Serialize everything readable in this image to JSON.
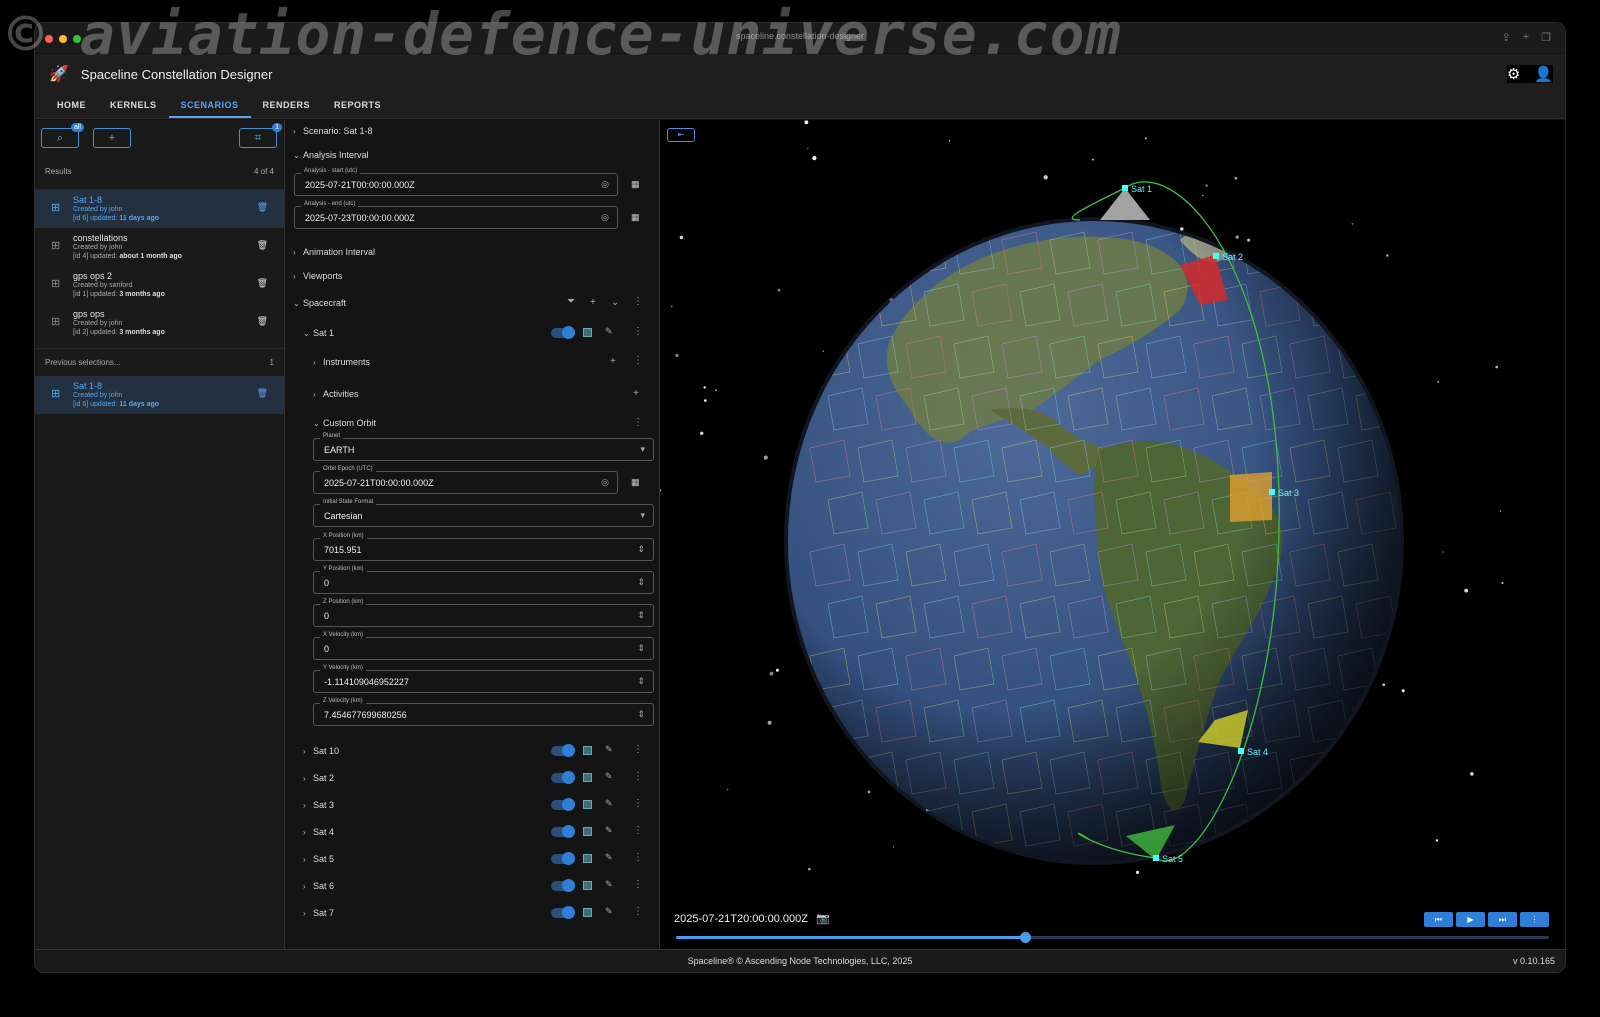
{
  "watermark": "© aviation-defence-universe.com",
  "browser": {
    "url": "spaceline.constellation-designer"
  },
  "app": {
    "title": "Spaceline Constellation Designer"
  },
  "tabs": [
    {
      "label": "HOME"
    },
    {
      "label": "KERNELS"
    },
    {
      "label": "SCENARIOS",
      "active": true
    },
    {
      "label": "RENDERS"
    },
    {
      "label": "REPORTS"
    }
  ],
  "left": {
    "search_badge": "all",
    "tag_badge": "1",
    "results_label": "Results",
    "results_count": "4 of 4",
    "items": [
      {
        "name": "Sat 1-8",
        "created": "Created by john",
        "id": "[id 6]",
        "updated_label": "updated:",
        "updated": "11 days ago",
        "selected": true
      },
      {
        "name": "constellations",
        "created": "Created by john",
        "id": "[id 4]",
        "updated_label": "updated:",
        "updated": "about 1 month ago"
      },
      {
        "name": "gps ops 2",
        "created": "Created by sanford",
        "id": "[id 1]",
        "updated_label": "updated:",
        "updated": "3 months ago"
      },
      {
        "name": "gps ops",
        "created": "Created by john",
        "id": "[id 2]",
        "updated_label": "updated:",
        "updated": "3 months ago"
      }
    ],
    "prev_label": "Previous selections...",
    "prev_count": "1",
    "prev_item": {
      "name": "Sat 1-8",
      "created": "Created by john",
      "id": "[id 6]",
      "updated_label": "updated:",
      "updated": "11 days ago"
    }
  },
  "mid": {
    "scenario": "Scenario: Sat 1-8",
    "analysis_interval": "Analysis Interval",
    "start_label": "Analysis - start (utc)",
    "start_value": "2025-07-21T00:00:00.000Z",
    "end_label": "Analysis - end (utc)",
    "end_value": "2025-07-23T00:00:00.000Z",
    "animation_interval": "Animation Interval",
    "viewports": "Viewports",
    "spacecraft": "Spacecraft",
    "sat1": "Sat 1",
    "instruments": "Instruments",
    "activities": "Activities",
    "custom_orbit": "Custom Orbit",
    "planet_label": "Planet",
    "planet_value": "EARTH",
    "epoch_label": "Orbit Epoch (UTC)",
    "epoch_value": "2025-07-21T00:00:00.000Z",
    "state_label": "Initial State Format",
    "state_value": "Cartesian",
    "xpos_label": "X Position (km)",
    "xpos_value": "7015.951",
    "ypos_label": "Y Position (km)",
    "ypos_value": "0",
    "zpos_label": "Z Position (km)",
    "zpos_value": "0",
    "xvel_label": "X Velocity (km)",
    "xvel_value": "0",
    "yvel_label": "Y Velocity (km)",
    "yvel_value": "-1.114109046952227",
    "zvel_label": "Z Velocity (km)",
    "zvel_value": "7.454677699680256",
    "sats": [
      "Sat 10",
      "Sat 2",
      "Sat 3",
      "Sat 4",
      "Sat 5",
      "Sat 6",
      "Sat 7"
    ]
  },
  "viewer": {
    "time": "2025-07-21T20:00:00.000Z",
    "progress": 0.4,
    "labels": [
      "Sat 1",
      "Sat 2",
      "Sat 3",
      "Sat 4",
      "Sat 5"
    ]
  },
  "footer": {
    "copyright": "Spaceline® © Ascending Node Technologies, LLC, 2025",
    "version": "v 0.10.165"
  },
  "colors": {
    "accent": "#2f7fd8",
    "orbit": "#3fbf3f",
    "sat2": "#d42a2a",
    "sat3": "#e0a030",
    "sat4": "#c8c82a",
    "sat5": "#3aa83a"
  }
}
